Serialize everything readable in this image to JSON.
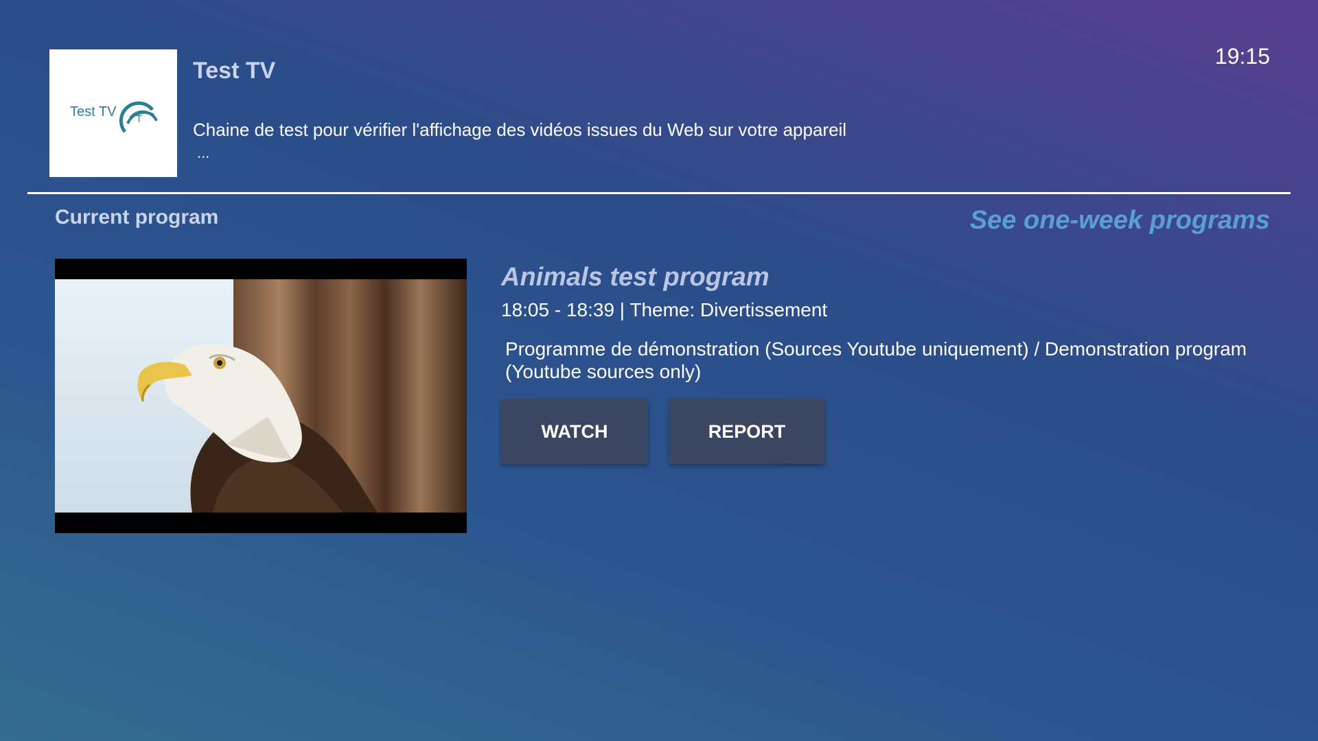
{
  "channel": {
    "logo_text": "Test TV",
    "logo_mark_letter": "T",
    "name": "Test TV",
    "description": "Chaine de test pour vérifier l'affichage des vidéos issues du Web sur votre appareil",
    "more": "..."
  },
  "clock": "19:15",
  "section": {
    "title": "Current program",
    "link": "See one-week programs"
  },
  "program": {
    "title": "Animals test program",
    "meta": "18:05 - 18:39 | Theme: Divertissement",
    "description": "Programme de démonstration (Sources Youtube uniquement) / Demonstration program (Youtube sources only)"
  },
  "buttons": {
    "watch": "WATCH",
    "report": "REPORT"
  },
  "colors": {
    "accent_link": "#5aa0cf",
    "button_bg": "#3d4660",
    "logo_teal": "#2a7f92"
  }
}
